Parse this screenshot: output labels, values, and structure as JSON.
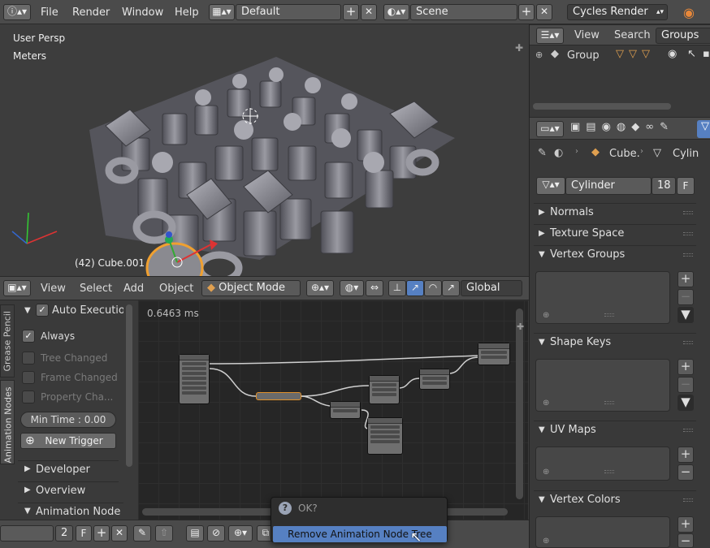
{
  "topbar": {
    "file": "File",
    "render": "Render",
    "window": "Window",
    "help": "Help",
    "layout": "Default",
    "scene": "Scene",
    "engine": "Cycles Render"
  },
  "viewport": {
    "view_name": "User Persp",
    "units": "Meters",
    "object_info": "(42) Cube.001"
  },
  "view3d_header": {
    "view": "View",
    "select": "Select",
    "add": "Add",
    "object": "Object",
    "mode": "Object Mode",
    "orientation": "Global"
  },
  "outliner": {
    "view": "View",
    "search": "Search",
    "groups": "Groups",
    "group_item": "Group"
  },
  "properties": {
    "breadcrumb_obj": "Cube.",
    "breadcrumb_mesh": "Cylin",
    "mesh_name": "Cylinder",
    "users": "18",
    "fake": "F",
    "sections": {
      "normals": "Normals",
      "texture_space": "Texture Space",
      "vertex_groups": "Vertex Groups",
      "shape_keys": "Shape Keys",
      "uv_maps": "UV Maps",
      "vertex_colors": "Vertex Colors"
    }
  },
  "node_tools": {
    "tab_grease": "Grease Pencil",
    "tab_anim": "Animation Nodes",
    "auto_exec": "Auto Execution",
    "always": "Always",
    "tree_changed": "Tree Changed",
    "frame_changed": "Frame Changed",
    "property_changed": "Property Cha...",
    "min_time": "Min Time : 0.00",
    "new_trigger": "New Trigger",
    "developer": "Developer",
    "overview": "Overview",
    "anim_node_tree": "Animation Node T"
  },
  "node_editor": {
    "exec_time": "0.6463 ms"
  },
  "bottombar": {
    "frame": "2",
    "f": "F"
  },
  "popup": {
    "title": "OK?",
    "action": "Remove Animation Node Tree"
  },
  "colors": {
    "accent": "#5680c2",
    "highlight": "#f0a030"
  }
}
